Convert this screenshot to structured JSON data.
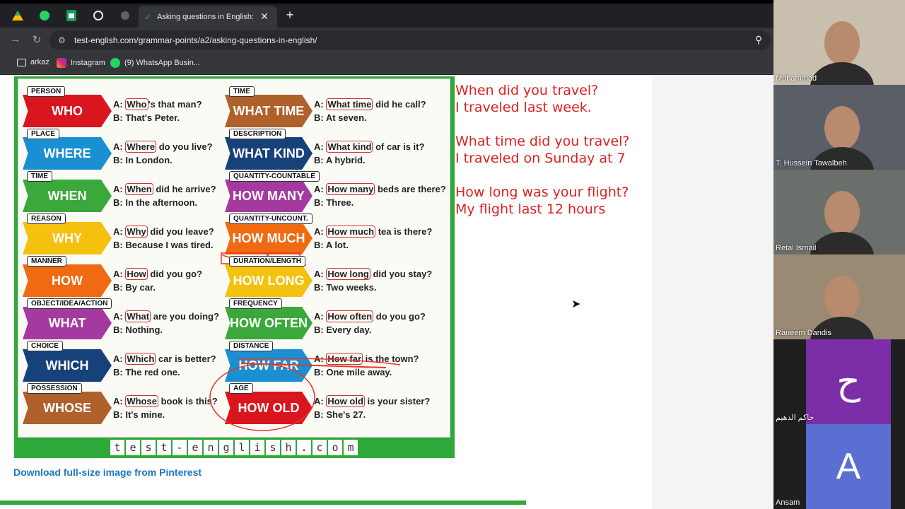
{
  "browser": {
    "active_tab_title": "Asking questions in English: Qu",
    "url": "test-english.com/grammar-points/a2/asking-questions-in-english/",
    "bookmarks": [
      "arkaz",
      "Instagram",
      "(9) WhatsApp Busin..."
    ]
  },
  "chart": {
    "left_column": [
      {
        "category": "PERSON",
        "word": "WHO",
        "color": "#d9151e",
        "a_hl": "Who",
        "a_rest": "'s that man?",
        "b": "B: That's Peter."
      },
      {
        "category": "PLACE",
        "word": "WHERE",
        "color": "#1a8fd1",
        "a_hl": "Where",
        "a_rest": " do you live?",
        "b": "B: In London."
      },
      {
        "category": "TIME",
        "word": "WHEN",
        "color": "#3aa83a",
        "a_hl": "When",
        "a_rest": " did he arrive?",
        "b": "B: In the afternoon."
      },
      {
        "category": "REASON",
        "word": "WHY",
        "color": "#f4c10f",
        "a_hl": "Why",
        "a_rest": " did you leave?",
        "b": "B: Because I was tired."
      },
      {
        "category": "MANNER",
        "word": "HOW",
        "color": "#f06a12",
        "a_hl": "How",
        "a_rest": " did you go?",
        "b": "B: By car."
      },
      {
        "category": "OBJECT/IDEA/ACTION",
        "word": "WHAT",
        "color": "#a43aa0",
        "a_hl": "What",
        "a_rest": " are you doing?",
        "b": "B: Nothing."
      },
      {
        "category": "CHOICE",
        "word": "WHICH",
        "color": "#17417a",
        "a_hl": "Which",
        "a_rest": " car is better?",
        "b": "B: The red one."
      },
      {
        "category": "POSSESSION",
        "word": "WHOSE",
        "color": "#b0602a",
        "a_hl": "Whose",
        "a_rest": " book is this?",
        "b": "B: It's mine."
      }
    ],
    "right_column": [
      {
        "category": "TIME",
        "word": "WHAT TIME",
        "color": "#b0602a",
        "a_hl": "What time",
        "a_rest": " did he call?",
        "b": "B: At seven."
      },
      {
        "category": "DESCRIPTION",
        "word": "WHAT KIND",
        "color": "#17417a",
        "a_hl": "What kind",
        "a_rest": " of car is it?",
        "b": "B: A hybrid."
      },
      {
        "category": "QUANTITY-COUNTABLE",
        "word": "HOW MANY",
        "color": "#a43aa0",
        "a_hl": "How many",
        "a_rest": " beds are there?",
        "b": "B: Three."
      },
      {
        "category": "QUANTITY-UNCOUNT.",
        "word": "HOW MUCH",
        "color": "#f06a12",
        "a_hl": "How much",
        "a_rest": " tea is there?",
        "b": "B: A lot."
      },
      {
        "category": "DURATION/LENGTH",
        "word": "HOW LONG",
        "color": "#f4c10f",
        "a_hl": "How long",
        "a_rest": " did you stay?",
        "b": "B: Two weeks."
      },
      {
        "category": "FREQUENCY",
        "word": "HOW OFTEN",
        "color": "#3aa83a",
        "a_hl": "How often",
        "a_rest": " do you go?",
        "b": "B: Every day."
      },
      {
        "category": "DISTANCE",
        "word": "HOW FAR",
        "color": "#1a8fd1",
        "a_hl": "How far",
        "a_rest": " is the town?",
        "b": "B: One mile away."
      },
      {
        "category": "AGE",
        "word": "HOW OLD",
        "color": "#d9151e",
        "a_hl": "How old",
        "a_rest": " is your sister?",
        "b": "B: She's 27."
      }
    ],
    "footer_logo": [
      "t",
      "e",
      "s",
      "t",
      "-",
      "e",
      "n",
      "g",
      "l",
      "i",
      "s",
      "h",
      ".",
      "c",
      "o",
      "m"
    ]
  },
  "notes": [
    [
      "When did you travel?",
      "I traveled last week."
    ],
    [
      "What time did you travel?",
      "I traveled on Sunday at 7"
    ],
    [
      "How long was your flight?",
      "My flight last 12 hours"
    ]
  ],
  "link_text": "Download full-size image from Pinterest",
  "participants": [
    {
      "name": "Mohammad",
      "type": "video",
      "bg": "#c9bfae"
    },
    {
      "name": "T. Hussein Tawalbeh",
      "type": "video",
      "bg": "#5a5e66"
    },
    {
      "name": "Retal Ismail",
      "type": "video",
      "bg": "#6a6f6b"
    },
    {
      "name": "Raneem Dandis",
      "type": "video",
      "bg": "#9a8a74"
    },
    {
      "name": "حاكم الدهيم",
      "type": "avatar",
      "letter": "ح",
      "bg": "#7b2ea8"
    },
    {
      "name": "Ansam",
      "type": "avatar",
      "letter": "A",
      "bg": "#5a6fd1"
    }
  ]
}
